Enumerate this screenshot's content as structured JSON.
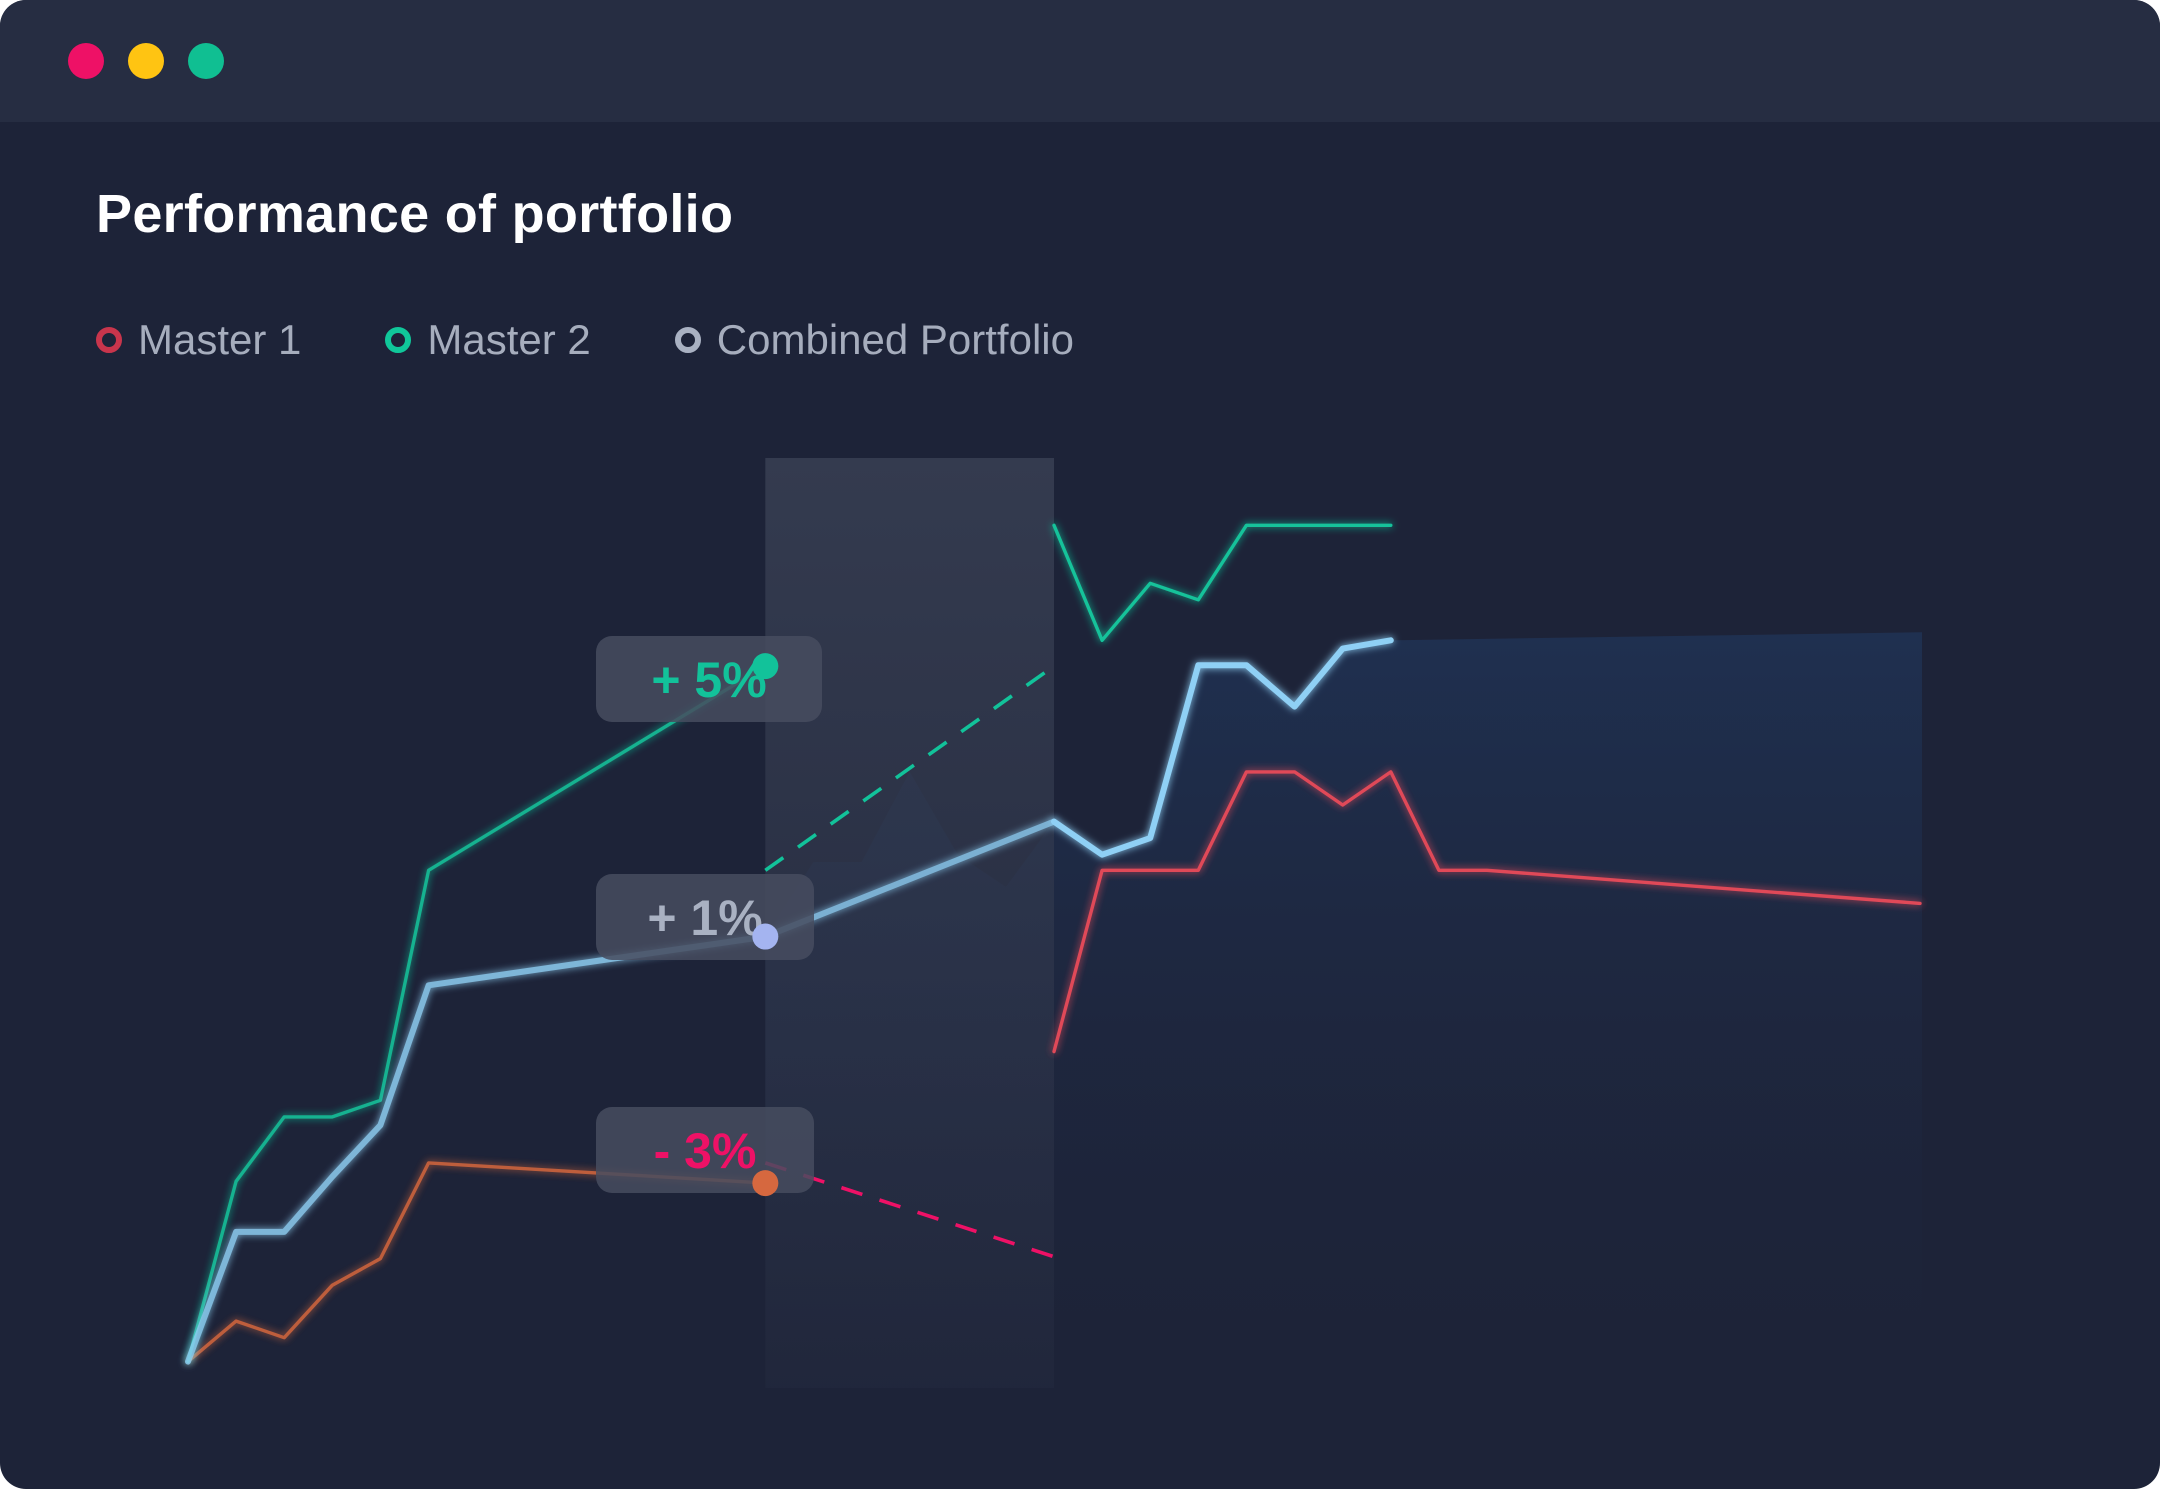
{
  "window": {
    "buttons": [
      {
        "name": "close",
        "color": "#ee1166"
      },
      {
        "name": "minimize",
        "color": "#ffc412"
      },
      {
        "name": "maximize",
        "color": "#10bf92"
      }
    ]
  },
  "chart_data": {
    "type": "line",
    "title": "Performance of portfolio",
    "legend": "top-left",
    "grid": false,
    "xlabel": "",
    "ylabel": "",
    "x": [
      0,
      0.5,
      1,
      1.5,
      2,
      2.5,
      3,
      3.5,
      4,
      4.5,
      5,
      5.5,
      6,
      6.5,
      7,
      7.5,
      8,
      8.5,
      9,
      9.5,
      10,
      10.5,
      11,
      11.5,
      12,
      12.5,
      13,
      13.5,
      14,
      14.5,
      15,
      15.5,
      16,
      16.5,
      17,
      17.5,
      18
    ],
    "ylim": [
      0,
      100
    ],
    "highlight_x": [
      6,
      9
    ],
    "series": [
      {
        "name": "Master 1",
        "color": "#e04858",
        "y": [
          2,
          6.4,
          4.6,
          10.3,
          13.2,
          23.6,
          null,
          null,
          null,
          null,
          null,
          null,
          21.4,
          21.4,
          30.4,
          30.4,
          39.3,
          39.3,
          35.7,
          55.4,
          55.4,
          55.4,
          66.1,
          66.1,
          62.5,
          66.1,
          55.4,
          55.4,
          null,
          null,
          null,
          null,
          null,
          null,
          null,
          null,
          51.8
        ],
        "pre_color": "#d0653d",
        "dashed_segment": [
          23.6,
          13.4
        ],
        "width": "normal"
      },
      {
        "name": "Master 2",
        "color": "#12c29a",
        "y": [
          2,
          21.6,
          28.6,
          28.6,
          30.4,
          55.4,
          null,
          null,
          null,
          null,
          null,
          null,
          77.6,
          81.3,
          87.5,
          81.3,
          83.9,
          78.6,
          92.9,
          80.4,
          86.6,
          84.8,
          92.9,
          92.9,
          92.9,
          92.9,
          null,
          null,
          null,
          null,
          null,
          null,
          null,
          null,
          null,
          null,
          null
        ],
        "dashed_segment": [
          55.4,
          77.6
        ],
        "width": "normal"
      },
      {
        "name": "Combined Portfolio",
        "color": "#8fd0f5",
        "y": [
          2,
          16.1,
          16.1,
          22.1,
          27.7,
          42.9,
          null,
          null,
          null,
          null,
          null,
          null,
          48.2,
          56.3,
          56.3,
          66.1,
          57.1,
          53.6,
          60.7,
          57.1,
          58.9,
          77.7,
          77.7,
          73.2,
          79.5,
          80.4,
          null,
          null,
          null,
          null,
          null,
          null,
          null,
          null,
          null,
          null,
          null
        ],
        "width": "bold"
      }
    ],
    "annotations": [
      {
        "text": "+ 5%",
        "color": "#12c29a"
      },
      {
        "text": "+ 1%",
        "color": "#a9b1c2"
      },
      {
        "text": "- 3%",
        "color": "#ee1166"
      }
    ]
  },
  "legend_items": [
    {
      "label": "Master 1",
      "color": "#c8354c"
    },
    {
      "label": "Master 2",
      "color": "#10c79a"
    },
    {
      "label": "Combined Portfolio",
      "color": "#a9b1c2"
    }
  ]
}
